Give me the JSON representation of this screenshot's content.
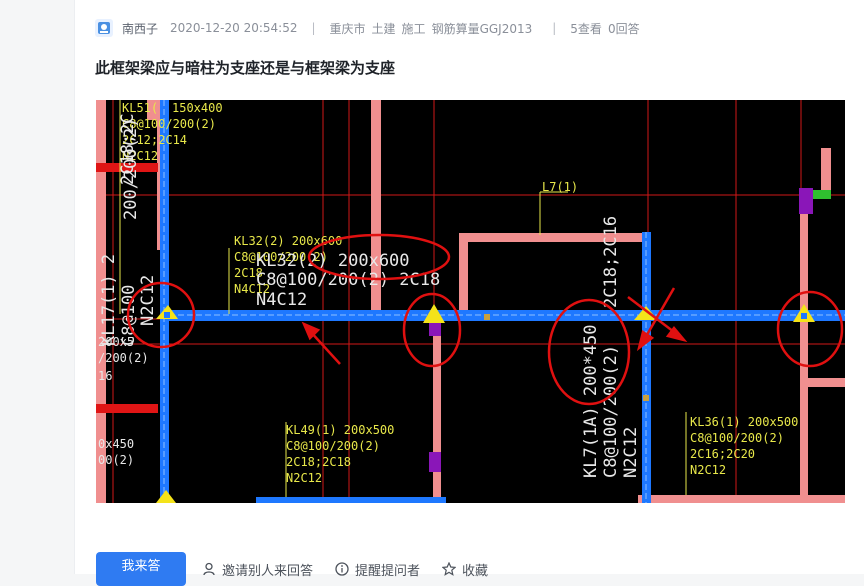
{
  "post": {
    "author": "南西子",
    "datetime": "2020-12-20 20:54:52",
    "separator": "|",
    "tags": [
      "重庆市",
      "土建",
      "施工",
      "钢筋算量GGJ2013"
    ],
    "views": "5查看",
    "answers": "0回答",
    "title": "此框架梁应与暗柱为支座还是与框架梁为支座"
  },
  "drawing": {
    "labels": [
      "KL51(",
      "150x400",
      "C8@100/200(2)",
      "2C12;2C14",
      "N2C12",
      "KL17(1) 2",
      "C8@100",
      "N2C12",
      "200x5",
      "/200(2)",
      "16",
      "0x450",
      "00(2)",
      "KL32(2) 200x600",
      "C8@100/200(2)",
      "2C18",
      "N4C12",
      "KL32(2) 200x600",
      "C8@100/200(2) 2C18",
      "N4C12",
      "L7(1)",
      "KL7(1A) 200*450",
      "C8@100/200(2)",
      "N2C12",
      "2C18;2C16",
      "KL49(1) 200x500",
      "C8@100/200(2)",
      "2C18;2C18",
      "N2C12",
      "KL36(1) 200x500",
      "C8@100/200(2)",
      "2C16;2C20",
      "N2C12",
      "2C18;2C",
      "200/200(2)"
    ],
    "colors": {
      "background": "#000000",
      "beam": "#1e78ff",
      "wall": "#f08f8f",
      "grid": "#d11717",
      "annotation": "#e8e84a",
      "markup": "#e01010",
      "column": "#8a16b8"
    }
  },
  "actions": {
    "answer": "我来答",
    "invite": "邀请别人来回答",
    "remind": "提醒提问者",
    "favorite": "收藏"
  }
}
